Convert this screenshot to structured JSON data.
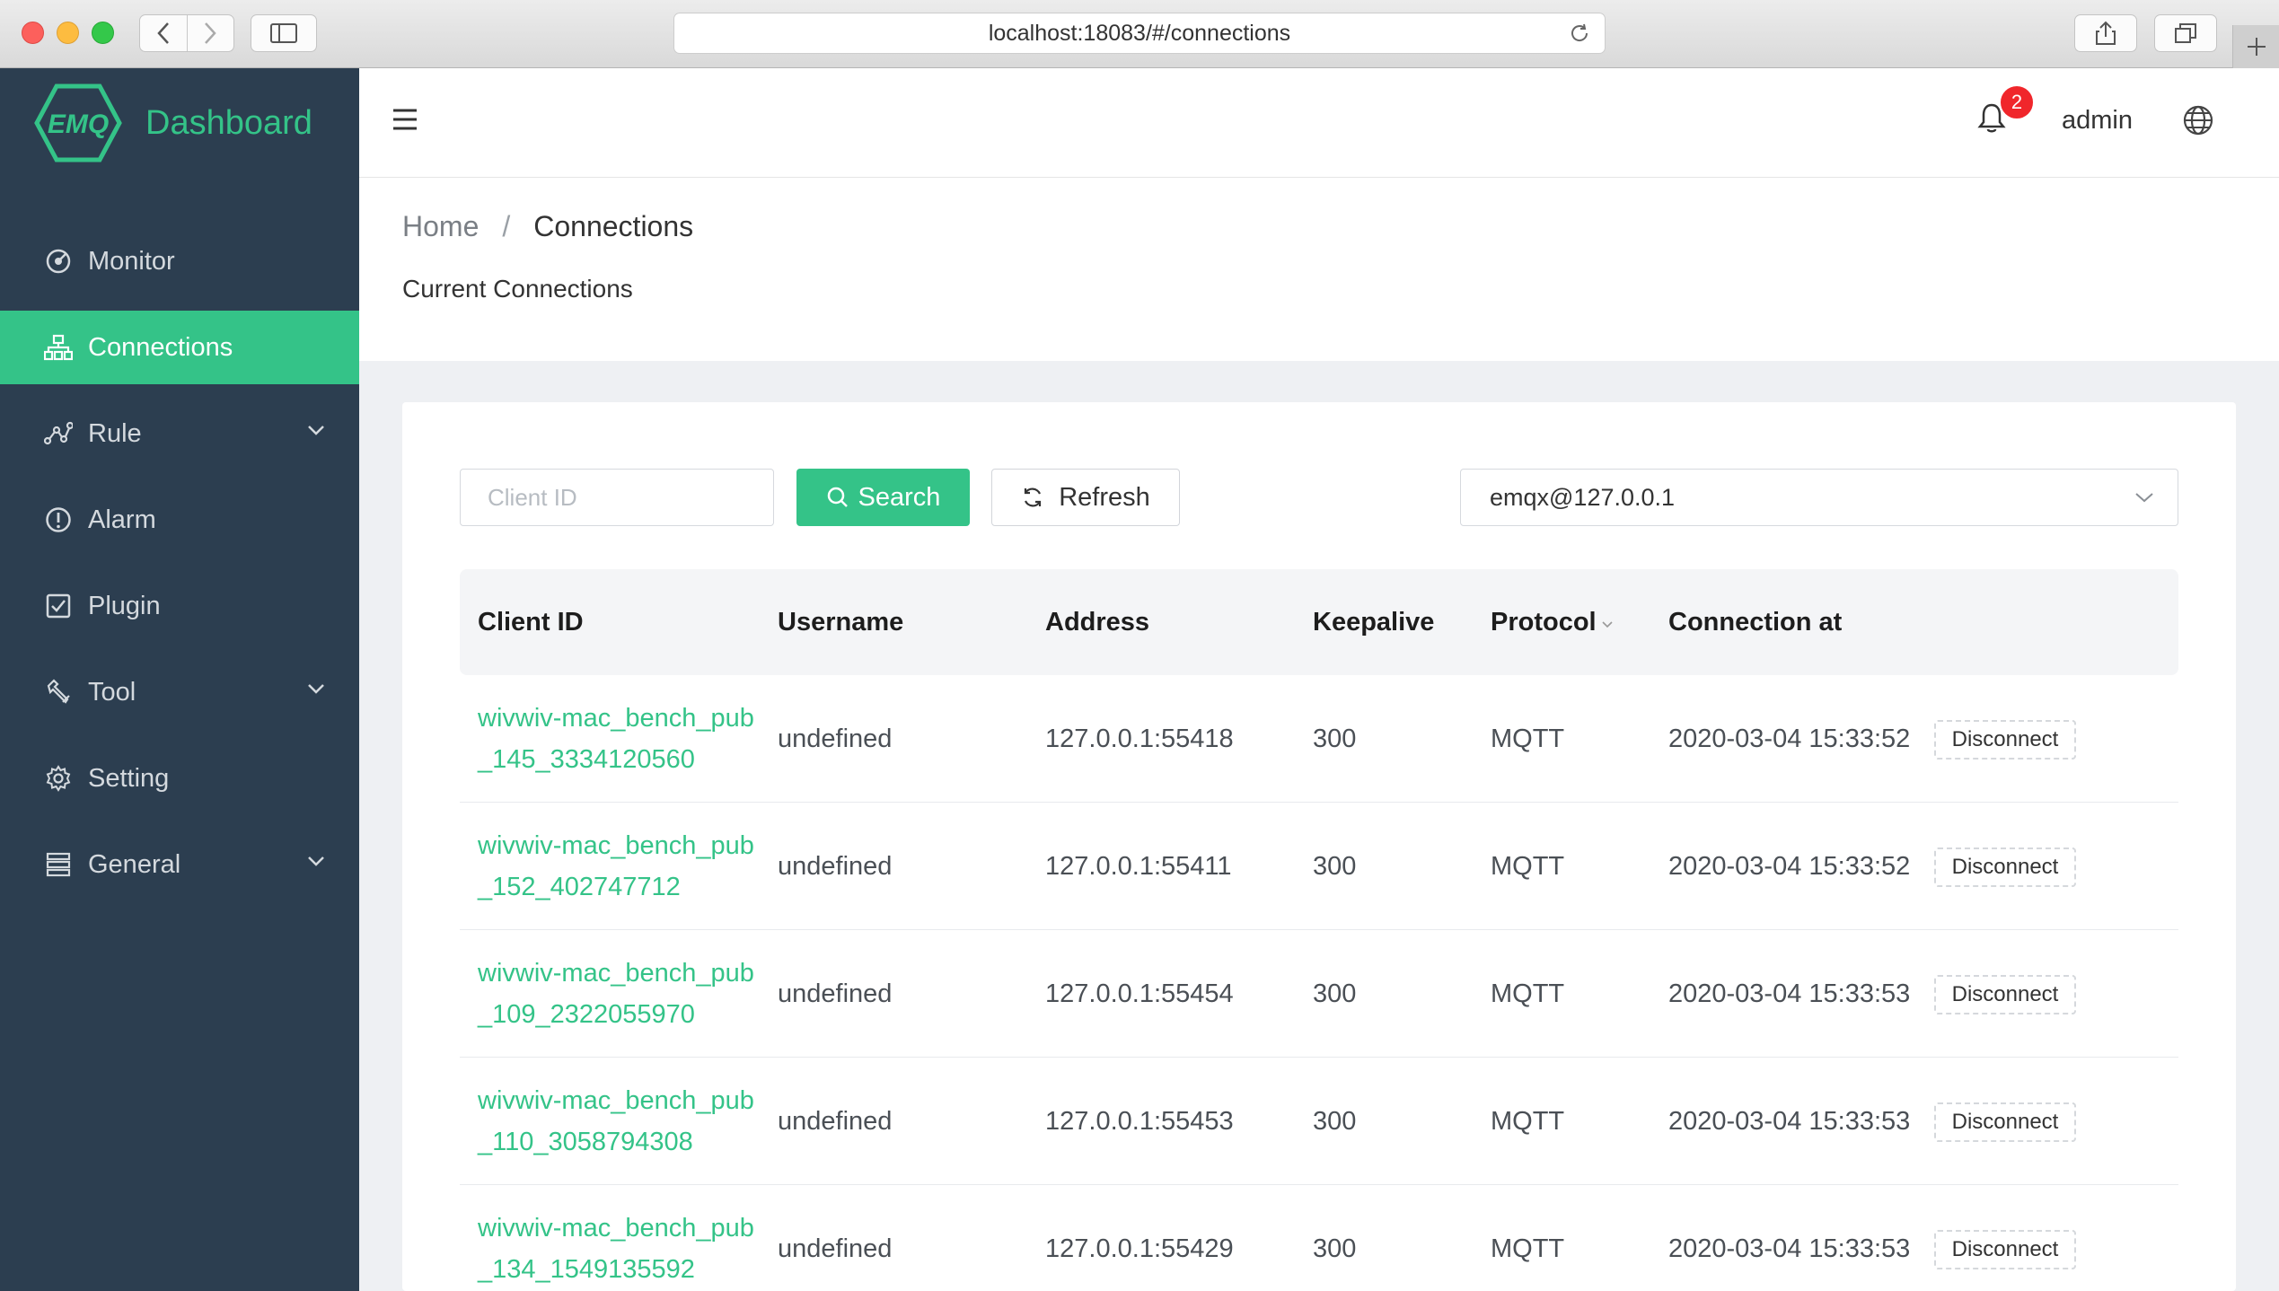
{
  "browser": {
    "url": "localhost:18083/#/connections"
  },
  "sidebar": {
    "logo_mark": "EMQ",
    "logo_text": "Dashboard",
    "items": [
      {
        "label": "Monitor",
        "icon": "monitor-icon",
        "active": false,
        "expandable": false
      },
      {
        "label": "Connections",
        "icon": "connections-icon",
        "active": true,
        "expandable": false
      },
      {
        "label": "Rule",
        "icon": "rule-icon",
        "active": false,
        "expandable": true
      },
      {
        "label": "Alarm",
        "icon": "alarm-icon",
        "active": false,
        "expandable": false
      },
      {
        "label": "Plugin",
        "icon": "plugin-icon",
        "active": false,
        "expandable": false
      },
      {
        "label": "Tool",
        "icon": "tool-icon",
        "active": false,
        "expandable": true
      },
      {
        "label": "Setting",
        "icon": "setting-icon",
        "active": false,
        "expandable": false
      },
      {
        "label": "General",
        "icon": "general-icon",
        "active": false,
        "expandable": true
      }
    ]
  },
  "header": {
    "notification_count": "2",
    "user": "admin"
  },
  "breadcrumb": {
    "home": "Home",
    "separator": "/",
    "current": "Connections"
  },
  "page": {
    "title": "Current Connections"
  },
  "toolbar": {
    "client_id_placeholder": "Client ID",
    "search_label": "Search",
    "refresh_label": "Refresh",
    "node_selected": "emqx@127.0.0.1"
  },
  "table": {
    "columns": [
      "Client ID",
      "Username",
      "Address",
      "Keepalive",
      "Protocol",
      "Connection at"
    ],
    "action_label": "Disconnect",
    "rows": [
      {
        "client_id": "wivwiv-mac_bench_pub_145_3334120560",
        "username": "undefined",
        "address": "127.0.0.1:55418",
        "keepalive": "300",
        "protocol": "MQTT",
        "connected_at": "2020-03-04 15:33:52"
      },
      {
        "client_id": "wivwiv-mac_bench_pub_152_402747712",
        "username": "undefined",
        "address": "127.0.0.1:55411",
        "keepalive": "300",
        "protocol": "MQTT",
        "connected_at": "2020-03-04 15:33:52"
      },
      {
        "client_id": "wivwiv-mac_bench_pub_109_2322055970",
        "username": "undefined",
        "address": "127.0.0.1:55454",
        "keepalive": "300",
        "protocol": "MQTT",
        "connected_at": "2020-03-04 15:33:53"
      },
      {
        "client_id": "wivwiv-mac_bench_pub_110_3058794308",
        "username": "undefined",
        "address": "127.0.0.1:55453",
        "keepalive": "300",
        "protocol": "MQTT",
        "connected_at": "2020-03-04 15:33:53"
      },
      {
        "client_id": "wivwiv-mac_bench_pub_134_1549135592",
        "username": "undefined",
        "address": "127.0.0.1:55429",
        "keepalive": "300",
        "protocol": "MQTT",
        "connected_at": "2020-03-04 15:33:53"
      }
    ]
  },
  "colors": {
    "brand": "#34c388",
    "sidebar_bg": "#2c3e50",
    "badge": "#f0262b"
  }
}
